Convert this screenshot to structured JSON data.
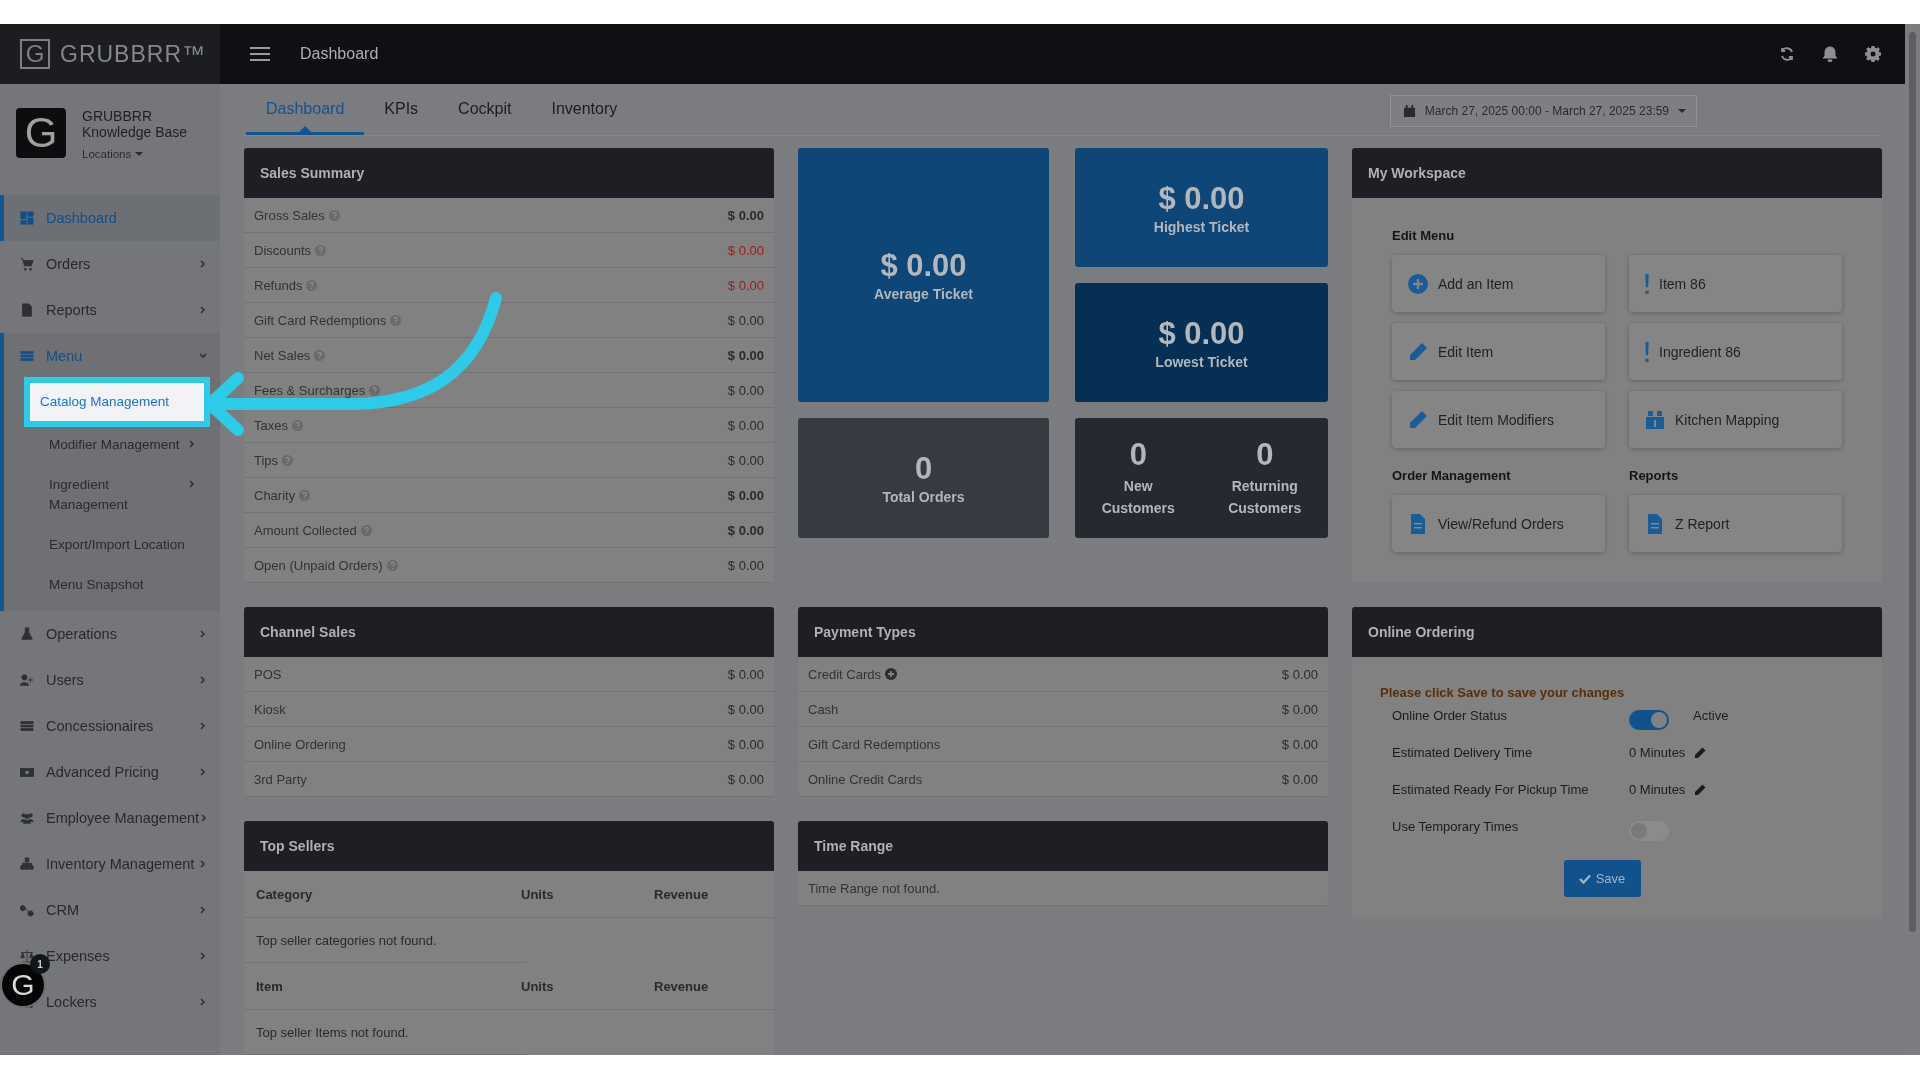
{
  "brand": {
    "mark": "G",
    "name": "GRUBBRR™"
  },
  "profile": {
    "mark": "G",
    "name": "GRUBBRR Knowledge Base",
    "locations": "Locations"
  },
  "sidebar": {
    "items": [
      {
        "label": "Dashboard",
        "selected": true,
        "has_submenu": false,
        "expanded": false
      },
      {
        "label": "Orders",
        "selected": false,
        "has_submenu": true,
        "expanded": false
      },
      {
        "label": "Reports",
        "selected": false,
        "has_submenu": true,
        "expanded": false
      },
      {
        "label": "Menu",
        "selected": false,
        "has_submenu": true,
        "expanded": true,
        "children": [
          {
            "label": "Catalog Management",
            "selected": true,
            "has_submenu": false
          },
          {
            "label": "Modifier Management",
            "selected": false,
            "has_submenu": true
          },
          {
            "label": "Ingredient Management",
            "selected": false,
            "has_submenu": true
          },
          {
            "label": "Export/Import Location",
            "selected": false,
            "has_submenu": false
          },
          {
            "label": "Menu Snapshot",
            "selected": false,
            "has_submenu": false
          }
        ]
      },
      {
        "label": "Operations",
        "selected": false,
        "has_submenu": true,
        "expanded": false
      },
      {
        "label": "Users",
        "selected": false,
        "has_submenu": true,
        "expanded": false
      },
      {
        "label": "Concessionaires",
        "selected": false,
        "has_submenu": true,
        "expanded": false
      },
      {
        "label": "Advanced Pricing",
        "selected": false,
        "has_submenu": true,
        "expanded": false
      },
      {
        "label": "Employee Management",
        "selected": false,
        "has_submenu": true,
        "expanded": false
      },
      {
        "label": "Inventory Management",
        "selected": false,
        "has_submenu": true,
        "expanded": false
      },
      {
        "label": "CRM",
        "selected": false,
        "has_submenu": true,
        "expanded": false
      },
      {
        "label": "Expenses",
        "selected": false,
        "has_submenu": true,
        "expanded": false
      },
      {
        "label": "Lockers",
        "selected": false,
        "has_submenu": true,
        "expanded": false
      }
    ]
  },
  "header": {
    "title": "Dashboard"
  },
  "tabs": [
    {
      "label": "Dashboard",
      "selected": true
    },
    {
      "label": "KPIs",
      "selected": false
    },
    {
      "label": "Cockpit",
      "selected": false
    },
    {
      "label": "Inventory",
      "selected": false
    }
  ],
  "date_range": "March 27, 2025 00:00 - March 27, 2025 23:59",
  "sales_summary": {
    "title": "Sales Summary",
    "rows": [
      {
        "label": "Gross Sales",
        "value": "$ 0.00",
        "negative": false,
        "emphasis": true
      },
      {
        "label": "Discounts",
        "value": "$ 0.00",
        "negative": true,
        "emphasis": false
      },
      {
        "label": "Refunds",
        "value": "$ 0.00",
        "negative": true,
        "emphasis": false
      },
      {
        "label": "Gift Card Redemptions",
        "value": "$ 0.00",
        "negative": false,
        "emphasis": false
      },
      {
        "label": "Net Sales",
        "value": "$ 0.00",
        "negative": false,
        "emphasis": true
      },
      {
        "label": "Fees & Surcharges",
        "value": "$ 0.00",
        "negative": false,
        "emphasis": false
      },
      {
        "label": "Taxes",
        "value": "$ 0.00",
        "negative": false,
        "emphasis": false
      },
      {
        "label": "Tips",
        "value": "$ 0.00",
        "negative": false,
        "emphasis": false
      },
      {
        "label": "Charity",
        "value": "$ 0.00",
        "negative": false,
        "emphasis": true
      },
      {
        "label": "Amount Collected",
        "value": "$ 0.00",
        "negative": false,
        "emphasis": true
      },
      {
        "label": "Open (Unpaid Orders)",
        "value": "$ 0.00",
        "negative": false,
        "emphasis": false
      }
    ]
  },
  "metrics": {
    "average": {
      "value": "$ 0.00",
      "label": "Average Ticket"
    },
    "highest": {
      "value": "$ 0.00",
      "label": "Highest Ticket"
    },
    "lowest": {
      "value": "$ 0.00",
      "label": "Lowest Ticket"
    },
    "orders": {
      "value": "0",
      "label": "Total Orders"
    },
    "customers": [
      {
        "value": "0",
        "label": "New Customers"
      },
      {
        "value": "0",
        "label": "Returning Customers"
      }
    ]
  },
  "workspace": {
    "title": "My Workspace",
    "sections": [
      {
        "heading": "Edit Menu",
        "actions": [
          {
            "label": "Add an Item",
            "kind": "add"
          },
          {
            "label": "Item 86",
            "kind": "alert"
          },
          {
            "label": "Edit Item",
            "kind": "edit"
          },
          {
            "label": "Ingredient 86",
            "kind": "alert"
          },
          {
            "label": "Edit Item Modifiers",
            "kind": "edit"
          },
          {
            "label": "Kitchen Mapping",
            "kind": "mapping"
          }
        ]
      },
      {
        "heading": "Order Management",
        "actions": [
          {
            "label": "View/Refund Orders",
            "kind": "document"
          }
        ]
      },
      {
        "heading": "Reports",
        "actions": [
          {
            "label": "Z Report",
            "kind": "document"
          }
        ]
      }
    ]
  },
  "channel_sales": {
    "title": "Channel Sales",
    "rows": [
      {
        "label": "POS",
        "value": "$ 0.00"
      },
      {
        "label": "Kiosk",
        "value": "$ 0.00"
      },
      {
        "label": "Online Ordering",
        "value": "$ 0.00"
      },
      {
        "label": "3rd Party",
        "value": "$ 0.00"
      }
    ]
  },
  "payment_types": {
    "title": "Payment Types",
    "rows": [
      {
        "label": "Credit Cards",
        "value": "$ 0.00",
        "expandable": true
      },
      {
        "label": "Cash",
        "value": "$ 0.00",
        "expandable": false
      },
      {
        "label": "Gift Card Redemptions",
        "value": "$ 0.00",
        "expandable": false
      },
      {
        "label": "Online Credit Cards",
        "value": "$ 0.00",
        "expandable": false
      }
    ]
  },
  "online_ordering": {
    "title": "Online Ordering",
    "note": "Please click Save to save your changes",
    "rows": [
      {
        "kind": "toggle",
        "label": "Online Order Status",
        "on": true,
        "status": "Active"
      },
      {
        "kind": "time",
        "label": "Estimated Delivery Time",
        "value": "0 Minutes"
      },
      {
        "kind": "time",
        "label": "Estimated Ready For Pickup Time",
        "value": "0 Minutes"
      },
      {
        "kind": "toggle",
        "label": "Use Temporary Times",
        "on": false
      }
    ],
    "save": "Save"
  },
  "top_sellers": {
    "title": "Top Sellers",
    "tables": [
      {
        "columns": [
          "Category",
          "Units",
          "Revenue"
        ],
        "empty": "Top seller categories not found."
      },
      {
        "columns": [
          "Item",
          "Units",
          "Revenue"
        ],
        "empty": "Top seller Items not found."
      }
    ]
  },
  "time_range": {
    "title": "Time Range",
    "empty": "Time Range not found."
  },
  "chat": {
    "mark": "G",
    "badge": "1"
  }
}
